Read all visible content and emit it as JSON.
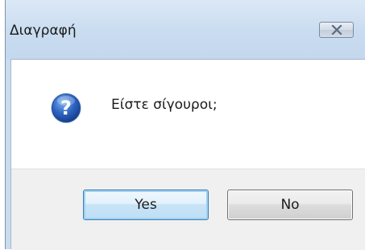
{
  "dialog": {
    "title": "Διαγραφή",
    "message": "Είστε σίγουροι;",
    "icon": "question-icon",
    "close_icon": "close-icon"
  },
  "buttons": {
    "yes_label": "Yes",
    "no_label": "No"
  },
  "colors": {
    "title_bar": "#c9dcf0",
    "content_background": "#ffffff",
    "button_panel": "#f0f0f0",
    "icon_blue": "#2b5fb3",
    "default_button_border": "#3c7fb1"
  }
}
